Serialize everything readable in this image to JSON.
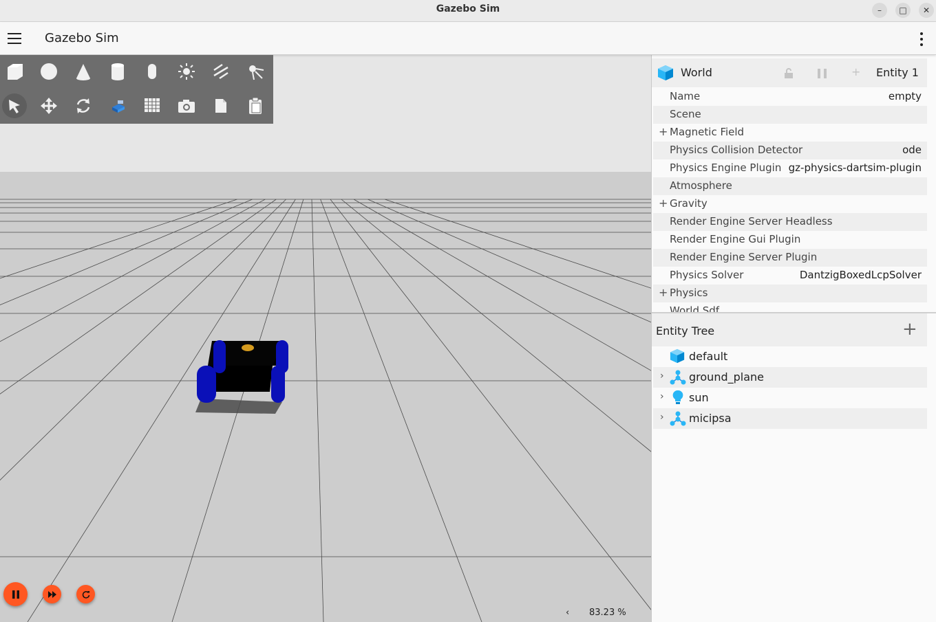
{
  "window": {
    "title": "Gazebo Sim"
  },
  "header": {
    "title": "Gazebo Sim"
  },
  "component_inspector": {
    "title": "World",
    "entity_label": "Entity 1",
    "properties": [
      {
        "key": "Name",
        "value": "empty",
        "expandable": false
      },
      {
        "key": "Scene",
        "value": "",
        "expandable": false
      },
      {
        "key": "Magnetic Field",
        "value": "",
        "expandable": true
      },
      {
        "key": "Physics Collision Detector",
        "value": "ode",
        "expandable": false
      },
      {
        "key": "Physics Engine Plugin",
        "value": "gz-physics-dartsim-plugin",
        "expandable": false
      },
      {
        "key": "Atmosphere",
        "value": "",
        "expandable": false
      },
      {
        "key": "Gravity",
        "value": "",
        "expandable": true
      },
      {
        "key": "Render Engine Server Headless",
        "value": "",
        "expandable": false
      },
      {
        "key": "Render Engine Gui Plugin",
        "value": "",
        "expandable": false
      },
      {
        "key": "Render Engine Server Plugin",
        "value": "",
        "expandable": false
      },
      {
        "key": "Physics Solver",
        "value": "DantzigBoxedLcpSolver",
        "expandable": false
      },
      {
        "key": "Physics",
        "value": "",
        "expandable": true
      },
      {
        "key": "World Sdf",
        "value": "",
        "expandable": false
      }
    ]
  },
  "entity_tree": {
    "title": "Entity Tree",
    "items": [
      {
        "name": "default",
        "icon": "world-icon",
        "expandable": false
      },
      {
        "name": "ground_plane",
        "icon": "model-icon",
        "expandable": true
      },
      {
        "name": "sun",
        "icon": "light-icon",
        "expandable": true
      },
      {
        "name": "micipsa",
        "icon": "model-icon",
        "expandable": true
      }
    ]
  },
  "toolbar": {
    "shapes": [
      "box-icon",
      "sphere-icon",
      "cone-icon",
      "cylinder-icon",
      "capsule-icon",
      "directional-light-icon",
      "spot-light-icon",
      "point-light-icon"
    ],
    "transform": [
      "select-icon",
      "translate-icon",
      "rotate-icon",
      "snap-icon",
      "grid-icon",
      "screenshot-icon",
      "copy-icon",
      "paste-icon"
    ]
  },
  "playback": {
    "real_time_factor": "83.23 %"
  },
  "colors": {
    "accent": "#ff5722",
    "wheels": "#0a10b8",
    "chassis": "#000000",
    "sensor": "#d49a1e",
    "entity_icon": "#29b6f6"
  }
}
